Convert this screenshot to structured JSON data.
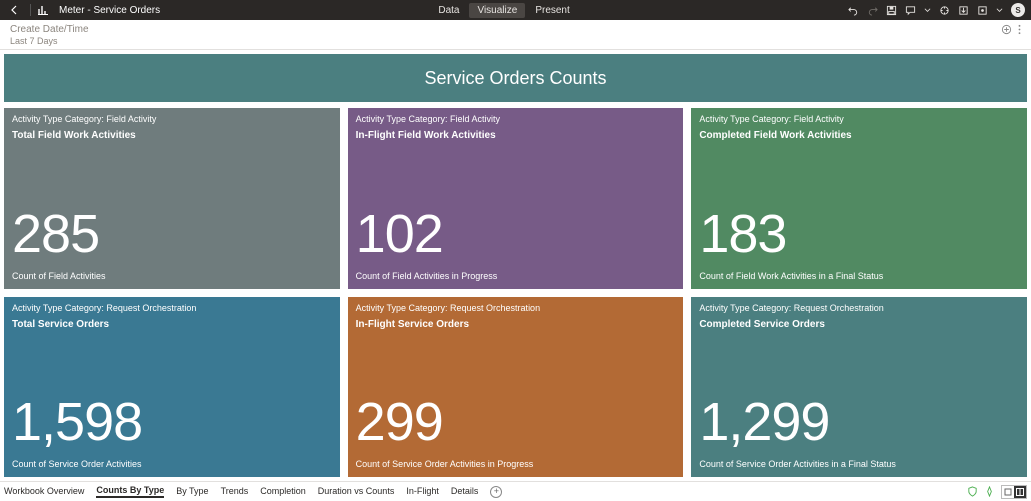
{
  "appbar": {
    "title": "Meter - Service Orders",
    "tabs": {
      "data": "Data",
      "visualize": "Visualize",
      "present": "Present"
    },
    "avatar_initial": "S"
  },
  "filter": {
    "label": "Create Date/Time",
    "value": "Last 7 Days"
  },
  "banner": {
    "title": "Service Orders Counts"
  },
  "tiles": [
    {
      "category": "Activity Type Category: Field Activity",
      "title": "Total Field Work Activities",
      "value": "285",
      "desc": "Count of Field Activities"
    },
    {
      "category": "Activity Type Category: Field Activity",
      "title": "In-Flight Field Work Activities",
      "value": "102",
      "desc": "Count of Field Activities in Progress"
    },
    {
      "category": "Activity Type Category: Field Activity",
      "title": "Completed Field Work Activities",
      "value": "183",
      "desc": "Count of Field Work Activities in a Final Status"
    },
    {
      "category": "Activity Type Category: Request Orchestration",
      "title": "Total Service Orders",
      "value": "1,598",
      "desc": "Count of Service Order Activities"
    },
    {
      "category": "Activity Type Category: Request Orchestration",
      "title": "In-Flight Service Orders",
      "value": "299",
      "desc": "Count of Service Order Activities in Progress"
    },
    {
      "category": "Activity Type Category: Request Orchestration",
      "title": "Completed Service Orders",
      "value": "1,299",
      "desc": "Count of Service Order Activities in a Final Status"
    }
  ],
  "bottom_tabs": {
    "items": [
      "Workbook Overview",
      "Counts By Type",
      "By Type",
      "Trends",
      "Completion",
      "Duration vs Counts",
      "In-Flight",
      "Details"
    ],
    "active_index": 1
  }
}
